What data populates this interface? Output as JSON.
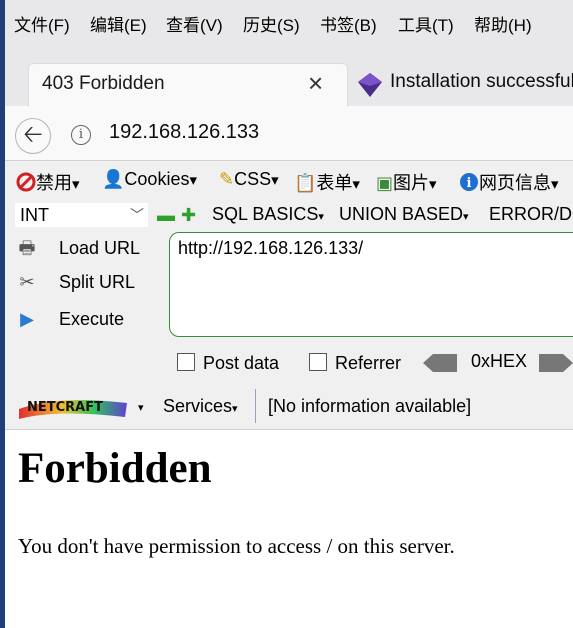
{
  "menubar": {
    "items": [
      "文件(F)",
      "编辑(E)",
      "查看(V)",
      "历史(S)",
      "书签(B)",
      "工具(T)",
      "帮助(H)"
    ]
  },
  "tabs": [
    {
      "title": "403 Forbidden",
      "close_icon": "close-icon"
    },
    {
      "title": "Installation successful",
      "icon": "php-diamond-icon"
    }
  ],
  "navbar": {
    "url": "192.168.126.133",
    "back_icon": "back-arrow-icon",
    "info_icon": "info-icon"
  },
  "webdev_toolbar": {
    "items": [
      "禁用",
      "Cookies",
      "CSS",
      "表单",
      "图片",
      "网页信息"
    ]
  },
  "hackbar": {
    "type_select": "INT",
    "menus": [
      "SQL BASICS",
      "UNION BASED",
      "ERROR/DO"
    ],
    "load_url": "Load URL",
    "split_url": "Split URL",
    "execute": "Execute",
    "url_value": "http://192.168.126.133/",
    "post_data": "Post data",
    "referrer": "Referrer",
    "hex": "0xHEX"
  },
  "netcraft": {
    "logo": "NETCRAFT",
    "services": "Services",
    "info": "[No information available]"
  },
  "page": {
    "heading": "Forbidden",
    "message": "You don't have permission to access / on this server."
  },
  "colors": {
    "accent_blue": "#1e3f78",
    "textarea_border": "#3c8a3c"
  }
}
